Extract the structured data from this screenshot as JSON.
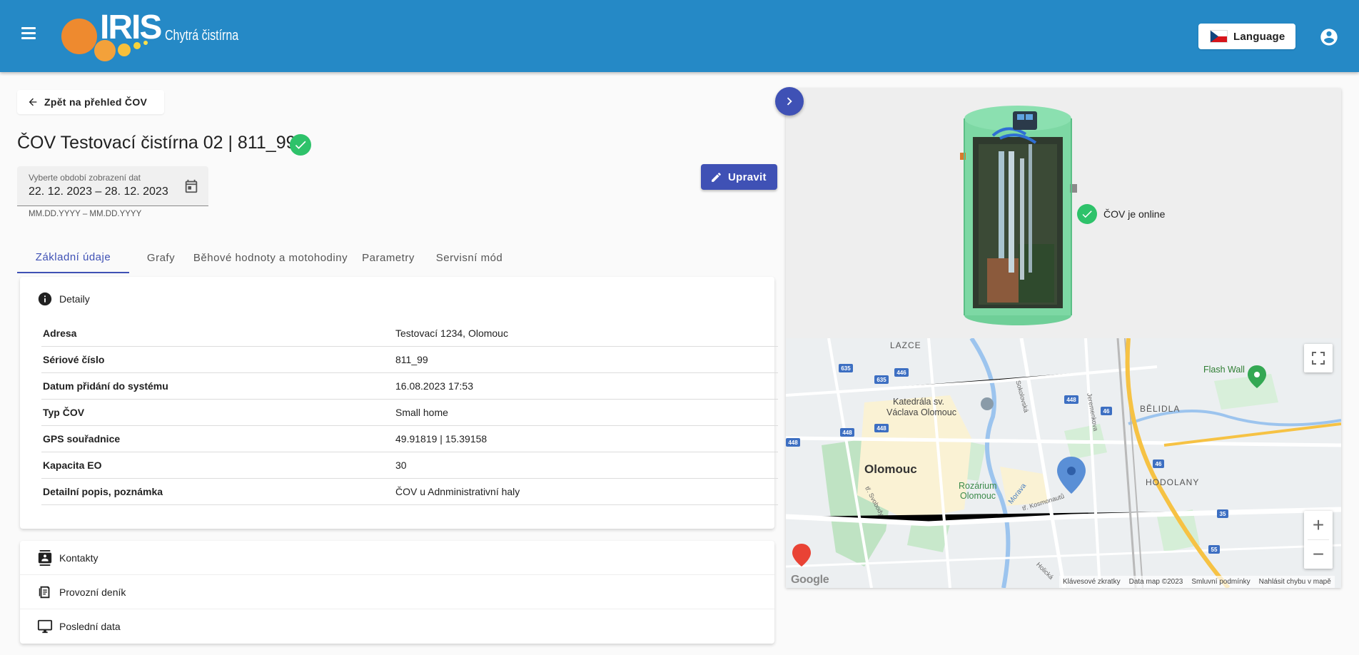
{
  "app": {
    "logo_text": "IRIS",
    "logo_subtitle": "Chytrá čistírna",
    "language_label": "Language",
    "icons": {
      "menu": "menu-icon",
      "flag": "czech-flag-icon",
      "account": "account-circle-icon"
    }
  },
  "page": {
    "back_label": "Zpět na přehled ČOV",
    "title": "ČOV Testovací čistírna 02 | 811_99",
    "edit_label": "Upravit"
  },
  "date_range": {
    "label": "Vyberte období zobrazení dat",
    "value": "22. 12. 2023 – 28. 12. 2023",
    "hint": "MM.DD.YYYY – MM.DD.YYYY"
  },
  "tabs": [
    {
      "label": "Základní údaje",
      "active": true
    },
    {
      "label": "Grafy",
      "active": false
    },
    {
      "label": "Běhové hodnoty a motohodiny",
      "active": false
    },
    {
      "label": "Parametry",
      "active": false
    },
    {
      "label": "Servisní mód",
      "active": false
    }
  ],
  "details": {
    "heading": "Detaily",
    "rows": [
      {
        "key": "Adresa",
        "value": "Testovací 1234, Olomouc"
      },
      {
        "key": "Sériové číslo",
        "value": "811_99"
      },
      {
        "key": "Datum přidání do systému",
        "value": "16.08.2023 17:53"
      },
      {
        "key": "Typ ČOV",
        "value": "Small home"
      },
      {
        "key": "GPS souřadnice",
        "value": "49.91819 | 15.39158"
      },
      {
        "key": "Kapacita EO",
        "value": "30"
      },
      {
        "key": "Detailní popis, poznámka",
        "value": "ČOV u Adnministrativní haly"
      }
    ]
  },
  "sections": [
    {
      "label": "Kontakty",
      "icon": "contact-card-icon"
    },
    {
      "label": "Provozní deník",
      "icon": "journal-icon"
    },
    {
      "label": "Poslední data",
      "icon": "monitor-icon"
    }
  ],
  "status": {
    "label": "ČOV je online",
    "color": "#2ec26a"
  },
  "map": {
    "labels": {
      "city": "Olomouc",
      "lazce": "LAZCE",
      "belidla": "BĚLIDLA",
      "hodolany": "HODOLANY",
      "katedrala1": "Katedrála sv.",
      "katedrala2": "Václava Olomouc",
      "rozarium1": "Rozárium",
      "rozarium2": "Olomouc",
      "flash_wall": "Flash Wall",
      "svobody": "tř. Svobody",
      "kosmonautu": "tř. Kosmonautů",
      "morava": "Morava",
      "sokolovska": "Sokolovská",
      "jeremenkova": "Jeremenkova",
      "holicka": "Holická"
    },
    "road_numbers": [
      "635",
      "635",
      "446",
      "448",
      "448",
      "448",
      "448",
      "46",
      "46",
      "35",
      "55"
    ],
    "footer": [
      "Klávesové zkratky",
      "Data map ©2023",
      "Smluvní podmínky",
      "Nahlásit chybu v mapě"
    ],
    "google_label": "Google"
  },
  "colors": {
    "primary": "#3f51b5",
    "appbar": "#2589c6",
    "success": "#2ec26a"
  }
}
